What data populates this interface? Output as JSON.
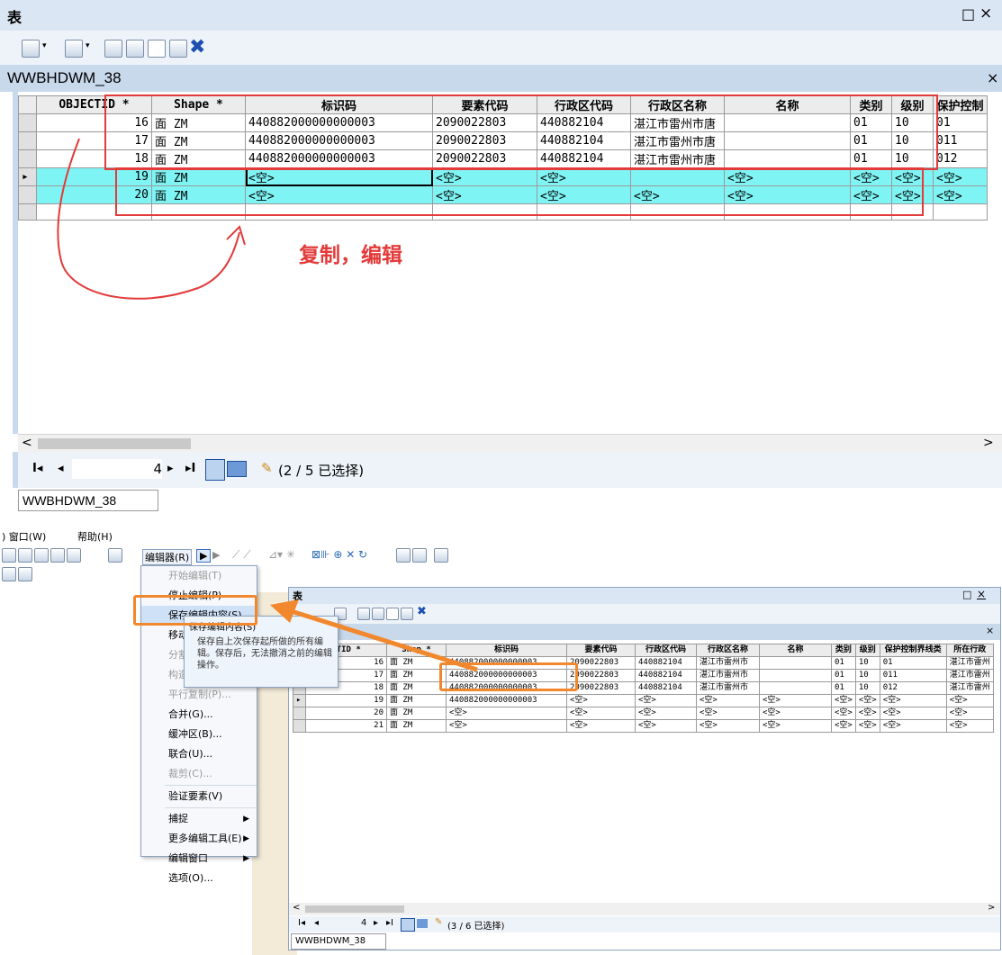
{
  "top": {
    "window_title": "表",
    "window_controls": [
      "□",
      "×"
    ],
    "toolbar_icons": [
      "table-options-icon",
      "related-tables-icon",
      "select-by-attributes-icon",
      "switch-selection-icon",
      "clear-selection-icon",
      "zoom-selected-icon",
      "delete-selected-icon"
    ],
    "tab_title": "WWBHDWM_38",
    "tab_close": "×",
    "columns": [
      "OBJECTID *",
      "Shape *",
      "标识码",
      "要素代码",
      "行政区代码",
      "行政区名称",
      "名称",
      "类别",
      "级别",
      "保护控制"
    ],
    "rows": [
      {
        "marker": "",
        "oid": "16",
        "shape": "面 ZM",
        "code": "440882000000000003",
        "fcode": "2090022803",
        "region_code": "440882104",
        "region_name": "湛江市雷州市唐",
        "name": "",
        "cat": "01",
        "level": "10",
        "ctrl": "01"
      },
      {
        "marker": "",
        "oid": "17",
        "shape": "面 ZM",
        "code": "440882000000000003",
        "fcode": "2090022803",
        "region_code": "440882104",
        "region_name": "湛江市雷州市唐",
        "name": "",
        "cat": "01",
        "level": "10",
        "ctrl": "011"
      },
      {
        "marker": "",
        "oid": "18",
        "shape": "面 ZM",
        "code": "440882000000000003",
        "fcode": "2090022803",
        "region_code": "440882104",
        "region_name": "湛江市雷州市唐",
        "name": "",
        "cat": "01",
        "level": "10",
        "ctrl": "012"
      },
      {
        "marker": "▸",
        "oid": "19",
        "shape": "面 ZM",
        "code": "<空>",
        "fcode": "<空>",
        "region_code": "<空>",
        "region_name": "",
        "name": "<空>",
        "cat": "<空>",
        "level": "<空>",
        "ctrl": "<空>"
      },
      {
        "marker": "",
        "oid": "20",
        "shape": "面 ZM",
        "code": "<空>",
        "fcode": "<空>",
        "region_code": "<空>",
        "region_name": "<空>",
        "name": "<空>",
        "cat": "<空>",
        "level": "<空>",
        "ctrl": "<空>"
      }
    ],
    "annotation": "复制，编辑",
    "nav_first": "I◂",
    "nav_prev": "◂",
    "record_value": "4",
    "nav_next": "▸",
    "nav_last": "▸I",
    "selection_status": "(2 / 5 已选择)",
    "bottom_tab": "WWBHDWM_38",
    "accent_red": "#e33a3a"
  },
  "bottom": {
    "menubar": [
      ") 窗口(W)",
      "帮助(H)"
    ],
    "editor_button": "编辑器(R)",
    "editor_menu": {
      "items": [
        {
          "label": "开始编辑(T)",
          "disabled": true
        },
        {
          "label": "停止编辑(P)",
          "disabled": false
        },
        {
          "label": "保存编辑内容(S)",
          "disabled": false,
          "highlight": true
        },
        {
          "label": "移动(M)...",
          "disabled": false
        },
        {
          "label": "分割(S)...",
          "disabled": true
        },
        {
          "label": "构造点(O)...",
          "disabled": true
        },
        {
          "label": "平行复制(P)...",
          "disabled": true
        },
        {
          "label": "合并(G)...",
          "disabled": false
        },
        {
          "label": "缓冲区(B)...",
          "disabled": false
        },
        {
          "label": "联合(U)...",
          "disabled": false
        },
        {
          "label": "裁剪(C)...",
          "disabled": true
        },
        {
          "label": "验证要素(V)",
          "disabled": false
        },
        {
          "label": "捕捉",
          "disabled": false,
          "submenu": true
        },
        {
          "label": "更多编辑工具(E)",
          "disabled": false,
          "submenu": true
        },
        {
          "label": "编辑窗口",
          "disabled": false,
          "submenu": true
        },
        {
          "label": "选项(O)...",
          "disabled": false
        }
      ]
    },
    "tooltip": {
      "title": "保存编辑内容(S)",
      "body": "保存自上次保存起所做的所有编辑。保存后，无法撤消之前的编辑操作。"
    },
    "window_title": "表",
    "window_controls": [
      "□",
      "×"
    ],
    "columns": [
      "CTID *",
      "Shap *",
      "标识码",
      "要素代码",
      "行政区代码",
      "行政区名称",
      "名称",
      "类别",
      "级别",
      "保护控制界线类",
      "所在行政"
    ],
    "rows": [
      {
        "marker": "",
        "oid": "16",
        "shape": "面 ZM",
        "code": "440882000000000003",
        "fcode": "2090022803",
        "region_code": "440882104",
        "region_name": "湛江市雷州市",
        "name": "",
        "cat": "01",
        "level": "10",
        "ctrl": "01",
        "loc": "湛江市雷州"
      },
      {
        "marker": "",
        "oid": "17",
        "shape": "面 ZM",
        "code": "440882000000000003",
        "fcode": "2090022803",
        "region_code": "440882104",
        "region_name": "湛江市雷州市",
        "name": "",
        "cat": "01",
        "level": "10",
        "ctrl": "011",
        "loc": "湛江市雷州"
      },
      {
        "marker": "",
        "oid": "18",
        "shape": "面 ZM",
        "code": "440882000000000003",
        "fcode": "2090022803",
        "region_code": "440882104",
        "region_name": "湛江市雷州市",
        "name": "",
        "cat": "01",
        "level": "10",
        "ctrl": "012",
        "loc": "湛江市雷州"
      },
      {
        "marker": "▸",
        "oid": "19",
        "shape": "面 ZM",
        "code": "440882000000000003",
        "fcode": "<空>",
        "region_code": "<空>",
        "region_name": "<空>",
        "name": "<空>",
        "cat": "<空>",
        "level": "<空>",
        "ctrl": "<空>",
        "loc": "<空>"
      },
      {
        "marker": "",
        "oid": "20",
        "shape": "面 ZM",
        "code": "<空>",
        "fcode": "<空>",
        "region_code": "<空>",
        "region_name": "<空>",
        "name": "<空>",
        "cat": "<空>",
        "level": "<空>",
        "ctrl": "<空>",
        "loc": "<空>"
      },
      {
        "marker": "",
        "oid": "21",
        "shape": "面 ZM",
        "code": "<空>",
        "fcode": "<空>",
        "region_code": "<空>",
        "region_name": "<空>",
        "name": "<空>",
        "cat": "<空>",
        "level": "<空>",
        "ctrl": "<空>",
        "loc": "<空>"
      }
    ],
    "nav_first": "I◂",
    "nav_prev": "◂",
    "record_value": "4",
    "nav_next": "▸",
    "nav_last": "▸I",
    "selection_status": "(3 / 6 已选择)",
    "bottom_tab": "WWBHDWM_38",
    "tab_close": "×",
    "accent_orange": "#f2882d"
  }
}
